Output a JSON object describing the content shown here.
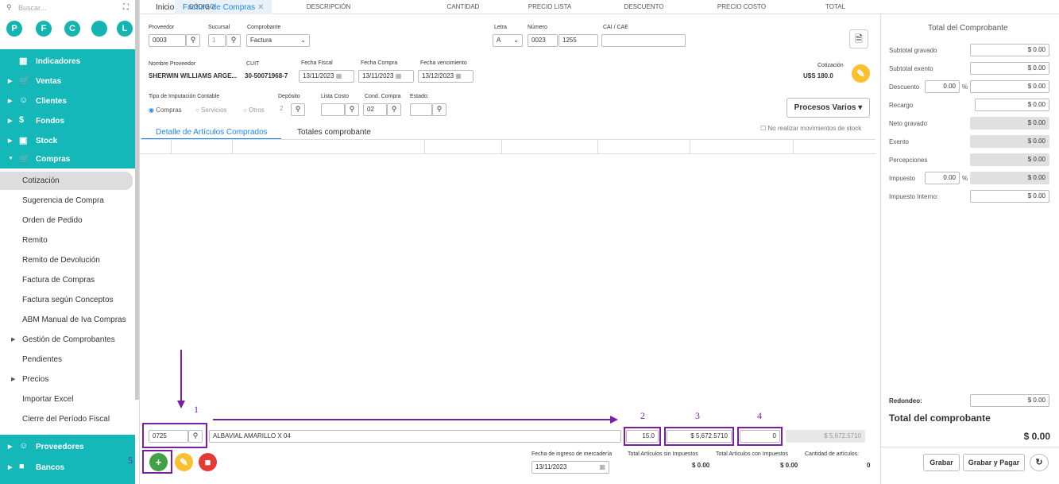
{
  "sidebar": {
    "search_placeholder": "Buscar...",
    "circles": [
      "P",
      "F",
      "C",
      "",
      "L"
    ],
    "top_menu": [
      {
        "label": "Indicadores"
      },
      {
        "label": "Ventas"
      },
      {
        "label": "Clientes"
      },
      {
        "label": "Fondos"
      },
      {
        "label": "Stock"
      },
      {
        "label": "Compras"
      }
    ],
    "compras_items": [
      "Cotización",
      "Sugerencia de Compra",
      "Orden de Pedido",
      "Remito",
      "Remito de Devolución",
      "Factura de Compras",
      "Factura según Conceptos",
      "ABM Manual de Iva Compras",
      "Gestión de Comprobantes",
      "Pendientes",
      "Precios",
      "Importar Excel",
      "Cierre del Período Fiscal"
    ],
    "bottom_menu": [
      {
        "label": "Proveedores"
      },
      {
        "label": "Bancos"
      }
    ]
  },
  "tabs": [
    {
      "label": "Inicio"
    },
    {
      "label": "Factura de Compras"
    }
  ],
  "form": {
    "proveedor_label": "Proveedor",
    "proveedor": "0003",
    "sucursal_label": "Sucursal",
    "sucursal": "1",
    "comprobante_label": "Comprobante",
    "comprobante": "Factura",
    "letra_label": "Letra",
    "letra": "A",
    "numero_label": "Número",
    "numero_a": "0023",
    "numero_b": "1255",
    "cai_label": "CAI / CAE",
    "nombre_label": "Nombre Proveedor",
    "nombre": "SHERWIN WILLIAMS ARGE...",
    "cuit_label": "CUIT",
    "cuit": "30-50071968-7",
    "fecha_fiscal_label": "Fecha Fiscal",
    "fecha_fiscal": "13/11/2023",
    "fecha_compra_label": "Fecha Compra",
    "fecha_compra": "13/11/2023",
    "fecha_venc_label": "Fecha vencimiento",
    "fecha_venc": "13/12/2023",
    "cotizacion_label": "Cotización",
    "cotizacion": "U$S 180.0",
    "tipo_label": "Tipo de Imputación Contable",
    "radios": [
      "Compras",
      "Servicios",
      "Otros"
    ],
    "deposito_label": "Depósito",
    "deposito": "2",
    "lista_label": "Lista Costo",
    "cond_label": "Cond. Compra",
    "cond": "02",
    "estado_label": "Estado:",
    "procesos": "Procesos Varios",
    "no_stock": "No realizar movimientos de stock"
  },
  "subtabs": [
    "Detalle de Artículos Comprados",
    "Totales comprobante"
  ],
  "table_headers": [
    "CÓDIGO",
    "DESCRIPCIÓN",
    "CANTIDAD",
    "PRECIO LISTA",
    "DESCUENTO",
    "PRECIO COSTO",
    "TOTAL"
  ],
  "entry": {
    "codigo": "0725",
    "descripcion": "ALBAVIAL AMARILLO X 04",
    "cantidad": "15.0",
    "precio": "$ 5,672.5710",
    "descuento": "0",
    "total": "$ 5,672.5710"
  },
  "footer": {
    "fecha_ingreso_label": "Fecha de ingreso de mercadería",
    "fecha_ingreso": "13/11/2023",
    "sin_imp_label": "Total Artículos sin Impuestos",
    "sin_imp": "$ 0.00",
    "con_imp_label": "Total Artículos con Impuestos",
    "con_imp": "$ 0.00",
    "cant_label": "Cantidad de artículos:",
    "cant": "0"
  },
  "annotations": [
    "1",
    "2",
    "3",
    "4",
    "5"
  ],
  "totals": {
    "title": "Total del Comprobante",
    "rows": [
      {
        "label": "Subtotal gravado",
        "value": "$ 0.00"
      },
      {
        "label": "Subtotal exento",
        "value": "$ 0.00"
      },
      {
        "label": "Descuento",
        "pct": "0.00",
        "value": "$ 0.00"
      },
      {
        "label": "Recargo",
        "value": "$ 0.00"
      },
      {
        "label": "Neto gravado",
        "value": "$ 0.00"
      },
      {
        "label": "Exento",
        "value": "$ 0.00"
      },
      {
        "label": "Percepciones",
        "value": "$ 0.00"
      },
      {
        "label": "Impuesto",
        "pct": "0.00",
        "value": "$ 0.00"
      },
      {
        "label": "Impuesto Interno:",
        "value": "$ 0.00"
      }
    ],
    "redondeo_label": "Redondeo:",
    "redondeo": "$ 0.00",
    "total_label": "Total del comprobante",
    "total": "$ 0.00",
    "pct_sign": "%"
  },
  "buttons": {
    "grabar": "Grabar",
    "grabar_pagar": "Grabar y Pagar"
  }
}
